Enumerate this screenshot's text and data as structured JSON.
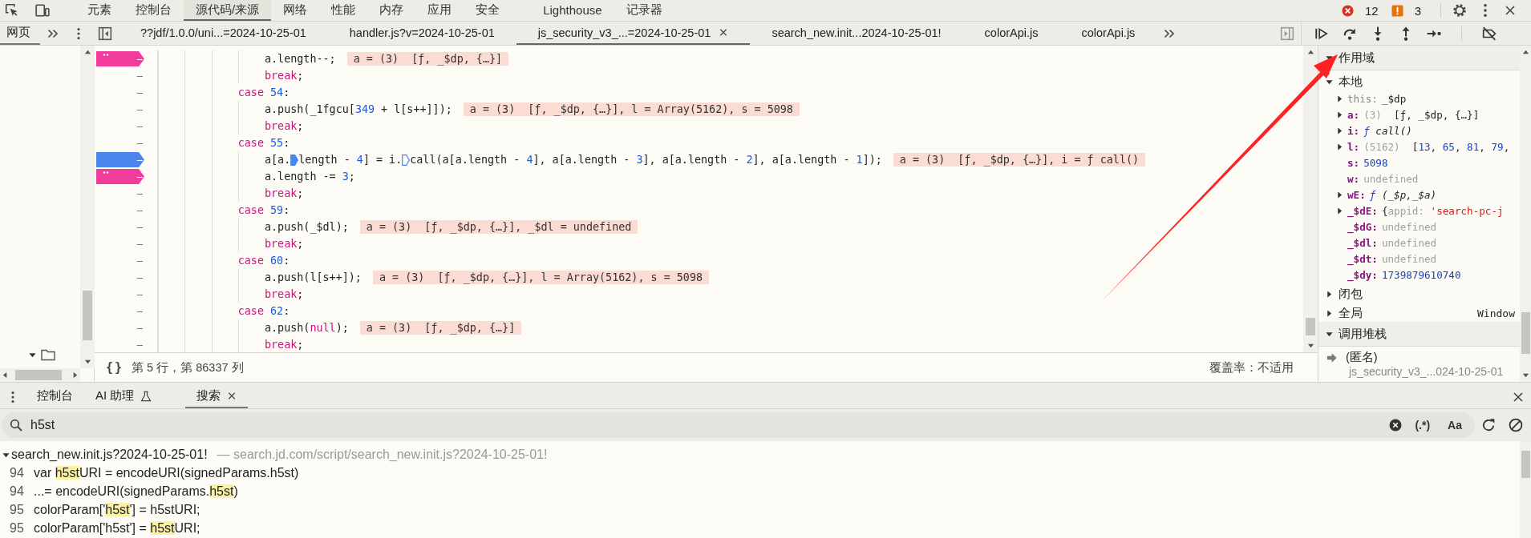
{
  "top_tabs": [
    {
      "label": "元素",
      "selected": false
    },
    {
      "label": "控制台",
      "selected": false
    },
    {
      "label": "源代码/来源",
      "selected": true
    },
    {
      "label": "网络",
      "selected": false
    },
    {
      "label": "性能",
      "selected": false
    },
    {
      "label": "内存",
      "selected": false
    },
    {
      "label": "应用",
      "selected": false
    },
    {
      "label": "安全",
      "selected": false
    },
    {
      "label": "Lighthouse",
      "selected": false
    },
    {
      "label": "记录器",
      "selected": false
    }
  ],
  "issue_counts": {
    "errors": "12",
    "warnings": "3"
  },
  "navigator_tab": {
    "label": "网页",
    "selected": true
  },
  "file_tabs": [
    {
      "label": "??jdf/1.0.0/uni...=2024-10-25-01",
      "selected": false,
      "closable": false
    },
    {
      "label": "handler.js?v=2024-10-25-01",
      "selected": false,
      "closable": false
    },
    {
      "label": "js_security_v3_...=2024-10-25-01",
      "selected": true,
      "closable": true
    },
    {
      "label": "search_new.init...2024-10-25-01!",
      "selected": false,
      "closable": false
    },
    {
      "label": "colorApi.js",
      "selected": false,
      "closable": false
    },
    {
      "label": "colorApi.js",
      "selected": false,
      "closable": false
    }
  ],
  "code_lines": [
    {
      "line_number": "–",
      "breakpoint": true,
      "conditional": true,
      "segments": [
        {
          "text": "                a.length--;",
          "kind": "plain"
        }
      ],
      "inline_value": "a = (3)  [ƒ, _$dp, {…}]"
    },
    {
      "line_number": "–",
      "breakpoint": false,
      "segments": [
        {
          "text": "                break",
          "kind": "keyword"
        },
        {
          "text": ";",
          "kind": "plain"
        }
      ]
    },
    {
      "line_number": "–",
      "breakpoint": false,
      "segments": [
        {
          "text": "            case ",
          "kind": "keyword"
        },
        {
          "text": "54",
          "kind": "number"
        },
        {
          "text": ":",
          "kind": "plain"
        }
      ]
    },
    {
      "line_number": "–",
      "breakpoint": false,
      "segments": [
        {
          "text": "                a.push(_1fgcu[",
          "kind": "plain"
        },
        {
          "text": "349",
          "kind": "number"
        },
        {
          "text": " + l[s++]]);",
          "kind": "plain"
        }
      ],
      "inline_value": "a = (3)  [ƒ, _$dp, {…}], l = Array(5162), s = 5098"
    },
    {
      "line_number": "–",
      "breakpoint": false,
      "segments": [
        {
          "text": "                break",
          "kind": "keyword"
        },
        {
          "text": ";",
          "kind": "plain"
        }
      ]
    },
    {
      "line_number": "–",
      "breakpoint": false,
      "segments": [
        {
          "text": "            case ",
          "kind": "keyword"
        },
        {
          "text": "55",
          "kind": "number"
        },
        {
          "text": ":",
          "kind": "plain"
        }
      ]
    },
    {
      "line_number": "–",
      "breakpoint": true,
      "conditional": false,
      "segments": [
        {
          "text": "                a[a.",
          "kind": "plain"
        },
        {
          "kind": "marker",
          "active": true
        },
        {
          "text": "length - ",
          "kind": "plain"
        },
        {
          "text": "4",
          "kind": "number"
        },
        {
          "text": "] = i.",
          "kind": "plain"
        },
        {
          "kind": "marker",
          "active": false
        },
        {
          "text": "call(a[a.length - ",
          "kind": "plain"
        },
        {
          "text": "4",
          "kind": "number"
        },
        {
          "text": "], a[a.length - ",
          "kind": "plain"
        },
        {
          "text": "3",
          "kind": "number"
        },
        {
          "text": "], a[a.length - ",
          "kind": "plain"
        },
        {
          "text": "2",
          "kind": "number"
        },
        {
          "text": "], a[a.length - ",
          "kind": "plain"
        },
        {
          "text": "1",
          "kind": "number"
        },
        {
          "text": "]);",
          "kind": "plain"
        }
      ],
      "inline_value": "a = (3)  [ƒ, _$dp, {…}], i = ƒ call()"
    },
    {
      "line_number": "–",
      "breakpoint": true,
      "conditional": true,
      "segments": [
        {
          "text": "                a.length -= ",
          "kind": "plain"
        },
        {
          "text": "3",
          "kind": "number"
        },
        {
          "text": ";",
          "kind": "plain"
        }
      ]
    },
    {
      "line_number": "–",
      "breakpoint": false,
      "segments": [
        {
          "text": "                break",
          "kind": "keyword"
        },
        {
          "text": ";",
          "kind": "plain"
        }
      ]
    },
    {
      "line_number": "–",
      "breakpoint": false,
      "segments": [
        {
          "text": "            case ",
          "kind": "keyword"
        },
        {
          "text": "59",
          "kind": "number"
        },
        {
          "text": ":",
          "kind": "plain"
        }
      ]
    },
    {
      "line_number": "–",
      "breakpoint": false,
      "segments": [
        {
          "text": "                a.push(_$dl);",
          "kind": "plain"
        }
      ],
      "inline_value": "a = (3)  [ƒ, _$dp, {…}], _$dl = undefined"
    },
    {
      "line_number": "–",
      "breakpoint": false,
      "segments": [
        {
          "text": "                break",
          "kind": "keyword"
        },
        {
          "text": ";",
          "kind": "plain"
        }
      ]
    },
    {
      "line_number": "–",
      "breakpoint": false,
      "segments": [
        {
          "text": "            case ",
          "kind": "keyword"
        },
        {
          "text": "60",
          "kind": "number"
        },
        {
          "text": ":",
          "kind": "plain"
        }
      ]
    },
    {
      "line_number": "–",
      "breakpoint": false,
      "segments": [
        {
          "text": "                a.push(l[s++]);",
          "kind": "plain"
        }
      ],
      "inline_value": "a = (3)  [ƒ, _$dp, {…}], l = Array(5162), s = 5098"
    },
    {
      "line_number": "–",
      "breakpoint": false,
      "segments": [
        {
          "text": "                break",
          "kind": "keyword"
        },
        {
          "text": ";",
          "kind": "plain"
        }
      ]
    },
    {
      "line_number": "–",
      "breakpoint": false,
      "segments": [
        {
          "text": "            case ",
          "kind": "keyword"
        },
        {
          "text": "62",
          "kind": "number"
        },
        {
          "text": ":",
          "kind": "plain"
        }
      ]
    },
    {
      "line_number": "–",
      "breakpoint": false,
      "segments": [
        {
          "text": "                a.push(",
          "kind": "plain"
        },
        {
          "text": "null",
          "kind": "keyword"
        },
        {
          "text": ");",
          "kind": "plain"
        }
      ],
      "inline_value": "a = (3)  [ƒ, _$dp, {…}]"
    },
    {
      "line_number": "–",
      "breakpoint": false,
      "segments": [
        {
          "text": "                break",
          "kind": "keyword"
        },
        {
          "text": ";",
          "kind": "plain"
        }
      ]
    }
  ],
  "editor_status": {
    "pretty_print": "{}",
    "cursor": "第 5 行，第 86337 列",
    "coverage": "覆盖率：不适用"
  },
  "scope": {
    "title": "作用域",
    "expanded": true,
    "groups": [
      {
        "label": "本地",
        "expanded": true,
        "children": [
          {
            "name": "this:",
            "kind": "this",
            "expandable": true,
            "value": [
              {
                "text": "_$dp",
                "kind": "plain"
              }
            ]
          },
          {
            "name": "a:",
            "kind": "var",
            "expandable": true,
            "value": [
              {
                "text": "(3)",
                "kind": "dim"
              },
              {
                "text": "  [ƒ, _$dp, {…}]",
                "kind": "plain"
              }
            ]
          },
          {
            "name": "i:",
            "kind": "var",
            "expandable": true,
            "value": [
              {
                "text": "ƒ",
                "kind": "fsign"
              },
              {
                "text": " call()",
                "kind": "function"
              }
            ]
          },
          {
            "name": "l:",
            "kind": "var",
            "expandable": true,
            "value": [
              {
                "text": "(5162)",
                "kind": "dim"
              },
              {
                "text": "  [",
                "kind": "plain"
              },
              {
                "text": "13",
                "kind": "number"
              },
              {
                "text": ", ",
                "kind": "plain"
              },
              {
                "text": "65",
                "kind": "number"
              },
              {
                "text": ", ",
                "kind": "plain"
              },
              {
                "text": "81",
                "kind": "number"
              },
              {
                "text": ", ",
                "kind": "plain"
              },
              {
                "text": "79",
                "kind": "number"
              },
              {
                "text": ",",
                "kind": "plain"
              }
            ]
          },
          {
            "name": "s:",
            "kind": "var",
            "expandable": false,
            "value": [
              {
                "text": "5098",
                "kind": "number"
              }
            ]
          },
          {
            "name": "w:",
            "kind": "var",
            "expandable": false,
            "value": [
              {
                "text": "undefined",
                "kind": "dim"
              }
            ]
          },
          {
            "name": "wE:",
            "kind": "var",
            "expandable": true,
            "value": [
              {
                "text": "ƒ",
                "kind": "fsign"
              },
              {
                "text": " (_$p,_$a)",
                "kind": "function"
              }
            ]
          },
          {
            "name": "_$dE:",
            "kind": "var",
            "expandable": true,
            "value": [
              {
                "text": "{",
                "kind": "plain"
              },
              {
                "text": "appid: ",
                "kind": "dim"
              },
              {
                "text": "'search-pc-j",
                "kind": "string"
              }
            ]
          },
          {
            "name": "_$dG:",
            "kind": "var",
            "expandable": false,
            "value": [
              {
                "text": "undefined",
                "kind": "dim"
              }
            ]
          },
          {
            "name": "_$dl:",
            "kind": "var",
            "expandable": false,
            "value": [
              {
                "text": "undefined",
                "kind": "dim"
              }
            ]
          },
          {
            "name": "_$dt:",
            "kind": "var",
            "expandable": false,
            "value": [
              {
                "text": "undefined",
                "kind": "dim"
              }
            ]
          },
          {
            "name": "_$dy:",
            "kind": "var",
            "expandable": false,
            "value": [
              {
                "text": "1739879610740",
                "kind": "number"
              }
            ]
          }
        ]
      },
      {
        "label": "闭包",
        "expanded": false
      },
      {
        "label": "全局",
        "expanded": false,
        "value": "Window"
      }
    ]
  },
  "call_stack": {
    "title": "调用堆栈",
    "expanded": true,
    "frames": [
      {
        "name": "(匿名)",
        "location": "js_security_v3_...024-10-25-01",
        "selected": true
      }
    ]
  },
  "drawer_tabs": [
    {
      "label": "控制台",
      "selected": false,
      "experimental": false,
      "closable": false
    },
    {
      "label": "AI 助理",
      "selected": false,
      "experimental": true,
      "closable": false
    },
    {
      "label": "搜索",
      "selected": true,
      "experimental": false,
      "closable": true
    }
  ],
  "search": {
    "value": "h5st",
    "regex_label": "(.*)",
    "case_label": "Aa"
  },
  "results": {
    "file": "search_new.init.js?2024-10-25-01!",
    "path": "— search.jd.com/script/search_new.init.js?2024-10-25-01!",
    "expanded": true,
    "matches": [
      {
        "line": "94",
        "segments": [
          {
            "text": "var ",
            "match": false
          },
          {
            "text": "h5st",
            "match": true
          },
          {
            "text": "URI = encodeURI(signedParams.h5st)",
            "match": false
          }
        ]
      },
      {
        "line": "94",
        "segments": [
          {
            "text": "...= encodeURI(signedParams.",
            "match": false
          },
          {
            "text": "h5st",
            "match": true
          },
          {
            "text": ")",
            "match": false
          }
        ]
      },
      {
        "line": "95",
        "segments": [
          {
            "text": "colorParam['",
            "match": false
          },
          {
            "text": "h5st",
            "match": true
          },
          {
            "text": "'] = h5stURI;",
            "match": false
          }
        ]
      },
      {
        "line": "95",
        "segments": [
          {
            "text": "colorParam['h5st'] = ",
            "match": false
          },
          {
            "text": "h5st",
            "match": true
          },
          {
            "text": "URI;",
            "match": false
          }
        ]
      }
    ]
  }
}
